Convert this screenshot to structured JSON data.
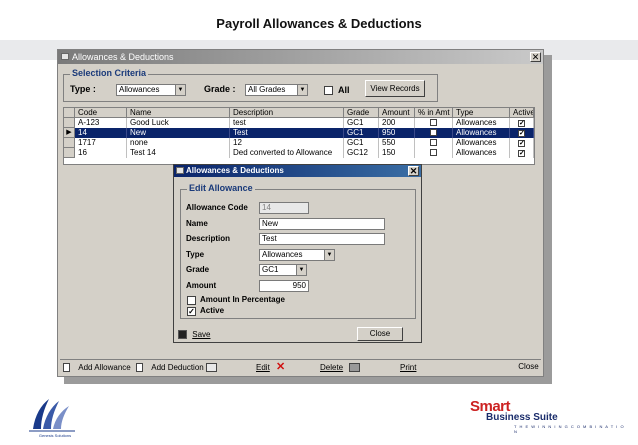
{
  "slide": {
    "title": "Payroll  Allowances & Deductions"
  },
  "window": {
    "title": "Allowances & Deductions"
  },
  "criteria": {
    "group_title": "Selection Criteria",
    "type_label": "Type :",
    "type_value": "Allowances",
    "grade_label": "Grade :",
    "grade_value": "All Grades",
    "all_label": "All",
    "view_records": "View Records"
  },
  "grid": {
    "headers": [
      "Code",
      "Name",
      "Description",
      "Grade",
      "Amount",
      "% in Amt",
      "Type",
      "Active"
    ],
    "rows": [
      {
        "code": "A-123",
        "name": "Good Luck",
        "description": "test",
        "grade": "GC1",
        "amount": "200",
        "pct": false,
        "type": "Allowances",
        "active": true
      },
      {
        "code": "14",
        "name": "New",
        "description": "Test",
        "grade": "GC1",
        "amount": "950",
        "pct": false,
        "type": "Allowances",
        "active": true
      },
      {
        "code": "1717",
        "name": "none",
        "description": "12",
        "grade": "GC1",
        "amount": "550",
        "pct": false,
        "type": "Allowances",
        "active": true
      },
      {
        "code": "16",
        "name": "Test 14",
        "description": "Ded converted to Allowance",
        "grade": "GC12",
        "amount": "150",
        "pct": false,
        "type": "Allowances",
        "active": true
      }
    ]
  },
  "dialog": {
    "title": "Allowances & Deductions",
    "group_title": "Edit Allowance",
    "code_label": "Allowance Code",
    "code_value": "14",
    "name_label": "Name",
    "name_value": "New",
    "desc_label": "Description",
    "desc_value": "Test",
    "type_label": "Type",
    "type_value": "Allowances",
    "grade_label": "Grade",
    "grade_value": "GC1",
    "amount_label": "Amount",
    "amount_value": "950",
    "pct_label": "Amount In Percentage",
    "active_label": "Active",
    "save_label": "Save",
    "close_label": "Close"
  },
  "toolbar": {
    "add_allowance": "Add Allowance",
    "add_deduction": "Add Deduction",
    "edit": "Edit",
    "delete": "Delete",
    "print": "Print",
    "close": "Close"
  },
  "brand": {
    "smart": "Smart",
    "suite": "Business Suite",
    "tagline": "T H E   W I N N I N G   C O M B I N A T I O N",
    "left_caption": "Genesis Solutions"
  }
}
